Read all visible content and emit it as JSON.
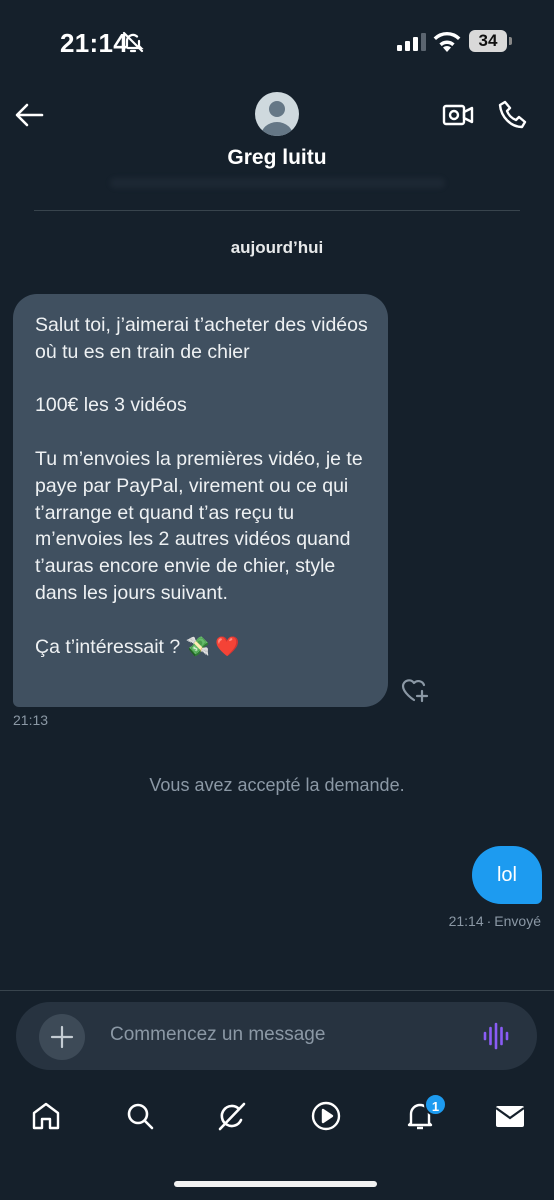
{
  "status_bar": {
    "time": "21:14",
    "battery": "34"
  },
  "header": {
    "contact_name": "Greg luitu"
  },
  "conversation": {
    "date_separator": "aujourd’hui",
    "incoming": {
      "text": "Salut toi, j’aimerai t’acheter des vidéos où tu es en train de chier\n\n100€ les 3 vidéos\n\nTu m’envoies la premières vidéo, je te paye par PayPal, virement ou ce qui t’arrange et quand t’as reçu tu m’envoies les 2 autres vidéos quand t’auras encore envie de chier, style dans les jours suivant.\n\nÇa t’intéressait ? 💸 ❤️",
      "time": "21:13"
    },
    "system_message": "Vous avez accepté la demande.",
    "outgoing": {
      "text": "lol",
      "time": "21:14",
      "status": "Envoyé"
    }
  },
  "composer": {
    "placeholder": "Commencez un message"
  },
  "tabbar": {
    "tabs": [
      "home-icon",
      "search-icon",
      "grok-icon",
      "video-icon",
      "notifications-icon",
      "messages-icon"
    ],
    "notifications_badge": "1"
  },
  "colors": {
    "background": "#15202b",
    "bubble_in": "#405060",
    "bubble_out": "#1d9bf0",
    "muted": "#8b98a5",
    "accent_voice": "#8a5cf6"
  }
}
